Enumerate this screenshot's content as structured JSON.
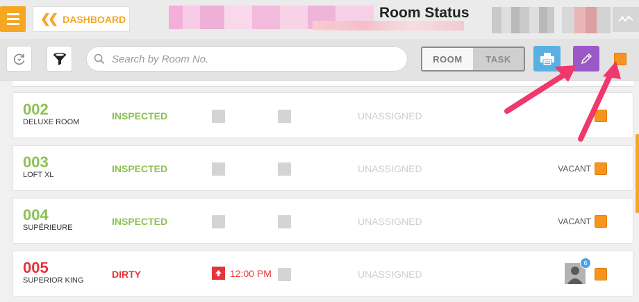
{
  "header": {
    "dashboard_label": "DASHBOARD",
    "title": "Room Status"
  },
  "toolbar": {
    "search_placeholder": "Search by Room No.",
    "segment": {
      "room": "ROOM",
      "task": "TASK",
      "selected": "ROOM"
    }
  },
  "rooms": [
    {
      "number": "002",
      "type": "DELUXE ROOM",
      "status": "INSPECTED",
      "assignee": "UNASSIGNED",
      "occupancy": ""
    },
    {
      "number": "003",
      "type": "LOFT XL",
      "status": "INSPECTED",
      "assignee": "UNASSIGNED",
      "occupancy": "VACANT"
    },
    {
      "number": "004",
      "type": "SUPÉRIEURE",
      "status": "INSPECTED",
      "assignee": "UNASSIGNED",
      "occupancy": "VACANT"
    },
    {
      "number": "005",
      "type": "SUPERIOR KING",
      "status": "DIRTY",
      "time": "12:00 PM",
      "assignee": "UNASSIGNED",
      "badge_count": "6"
    }
  ],
  "colors": {
    "accent": "#f5a623",
    "inspected": "#8cc152",
    "dirty": "#e5343a",
    "print": "#5bb0e3",
    "edit": "#9b59c7",
    "annotation_arrow": "#f0386b"
  },
  "icons": [
    "menu-icon",
    "chevrons-left-icon",
    "activity-icon",
    "refresh-icon",
    "filter-funnel-icon",
    "search-icon",
    "print-icon",
    "pencil-icon",
    "arrow-up-icon",
    "user-avatar-icon"
  ]
}
